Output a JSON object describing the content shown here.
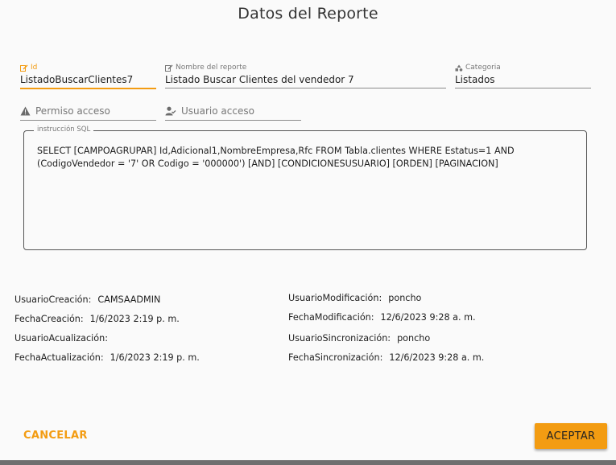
{
  "dialog": {
    "title": "Datos del Reporte"
  },
  "fields": {
    "id": {
      "label": "Id",
      "value": "ListadoBuscarClientes7"
    },
    "nombre": {
      "label": "Nombre del reporte",
      "value": "Listado Buscar Clientes del vendedor 7"
    },
    "categoria": {
      "label": "Categoria",
      "value": "Listados"
    },
    "permiso": {
      "placeholder": "Permiso acceso"
    },
    "usuario": {
      "placeholder": "Usuario acceso"
    }
  },
  "sql": {
    "label": "instrucción SQL",
    "text": "SELECT [CAMPOAGRUPAR] Id,Adicional1,NombreEmpresa,Rfc FROM Tabla.clientes WHERE Estatus=1 AND (CodigoVendedor = '7' OR Codigo = '000000') [AND] [CONDICIONESUSUARIO] [ORDEN] [PAGINACION]"
  },
  "meta": {
    "left": [
      {
        "key": "UsuarioCreación:",
        "value": "CAMSAADMIN"
      },
      {
        "key": "FechaCreación:",
        "value": "1/6/2023 2:19 p. m."
      },
      {
        "key": "UsuarioAcualización:",
        "value": ""
      },
      {
        "key": "FechaActualización:",
        "value": "1/6/2023 2:19 p. m."
      }
    ],
    "right": [
      {
        "key": "UsuarioModificación:",
        "value": "poncho"
      },
      {
        "key": "FechaModificación:",
        "value": "12/6/2023 9:28 a. m."
      },
      {
        "key": "UsuarioSincronización:",
        "value": "poncho"
      },
      {
        "key": "FechaSincronización:",
        "value": "12/6/2023 9:28 a. m."
      }
    ]
  },
  "actions": {
    "cancel": "CANCELAR",
    "accept": "ACEPTAR"
  },
  "colors": {
    "accent": "#f39c12",
    "background": "#fafafa"
  },
  "icons": {
    "id": "edit-note-icon",
    "nombre": "edit-note-icon",
    "categoria": "category-icon",
    "permiso": "warning-icon",
    "usuario": "user-check-icon"
  }
}
